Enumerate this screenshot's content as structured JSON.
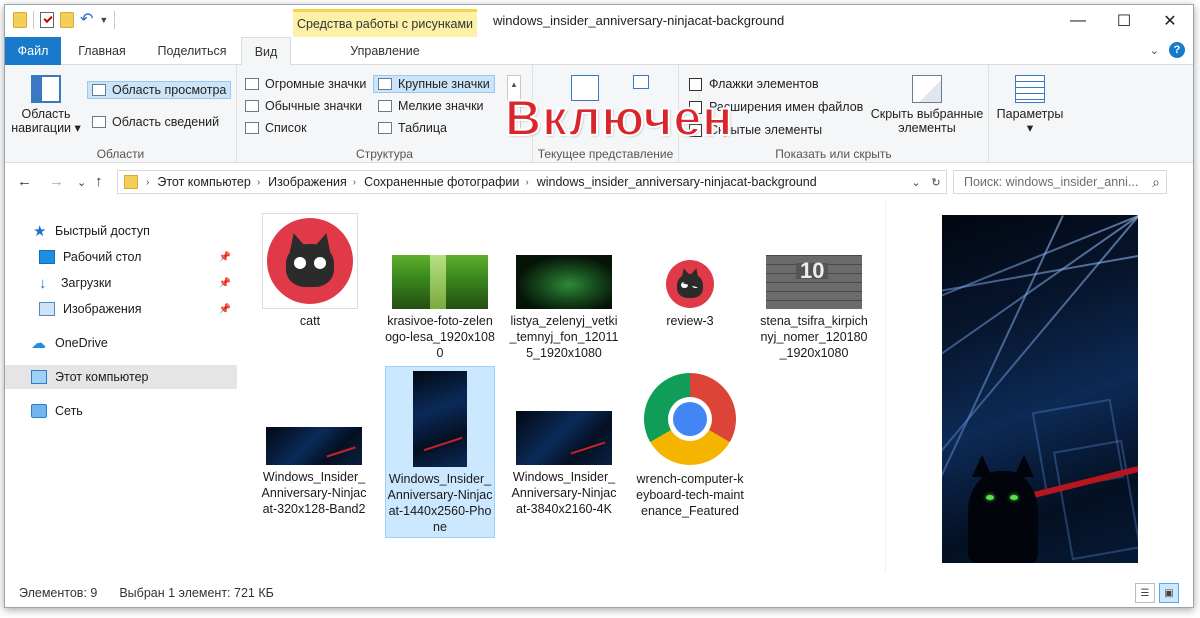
{
  "window": {
    "title": "windows_insider_anniversary-ninjacat-background",
    "context_tools": "Средства работы с рисунками",
    "controls": {
      "minimize": "—",
      "maximize": "☐",
      "close": "✕"
    }
  },
  "ribbon_tabs": {
    "file": "Файл",
    "home": "Главная",
    "share": "Поделиться",
    "view": "Вид",
    "manage": "Управление",
    "collapse": "⌄",
    "help": "?"
  },
  "ribbon": {
    "panes": {
      "label": "Области",
      "nav_pane_line1": "Область",
      "nav_pane_line2": "навигации ▾",
      "preview_pane": "Область просмотра",
      "details_pane": "Область сведений"
    },
    "layout": {
      "label": "Структура",
      "extra_large": "Огромные значки",
      "large": "Крупные значки",
      "medium": "Обычные значки",
      "small": "Мелкие значки",
      "list": "Список",
      "details": "Таблица"
    },
    "current_view": {
      "label": "Текущее представление"
    },
    "show_hide": {
      "label": "Показать или скрыть",
      "item_checkboxes": "Флажки элементов",
      "file_extensions": "Расширения имен файлов",
      "hidden_items": "Скрытые элементы",
      "hide_selected_line1": "Скрыть выбранные",
      "hide_selected_line2": "элементы"
    },
    "options": {
      "label": "Параметры ▾"
    }
  },
  "overlay": {
    "text": "Включен"
  },
  "address": {
    "back": "←",
    "forward": "→",
    "recent": "⌄",
    "up": "↑",
    "crumbs": [
      "Этот компьютер",
      "Изображения",
      "Сохраненные фотографии",
      "windows_insider_anniversary-ninjacat-background"
    ],
    "separator": "›",
    "dropdown": "⌄",
    "refresh": "↻"
  },
  "search": {
    "placeholder": "Поиск: windows_insider_anni...",
    "icon": "⌕"
  },
  "sidebar": {
    "quick_access": "Быстрый доступ",
    "desktop": "Рабочий стол",
    "downloads": "Загрузки",
    "pictures": "Изображения",
    "onedrive": "OneDrive",
    "this_pc": "Этот компьютер",
    "network": "Сеть",
    "pin": "📌"
  },
  "files": [
    {
      "name": "catt"
    },
    {
      "name": "krasivoe-foto-zelenogo-lesa_1920x1080"
    },
    {
      "name": "listya_zelenyj_vetki_temnyj_fon_120115_1920x1080"
    },
    {
      "name": "review-3"
    },
    {
      "name": "stena_tsifra_kirpichnyj_nomer_120180_1920x1080"
    },
    {
      "name": "Windows_Insider_Anniversary-Ninjacat-320x128-Band2"
    },
    {
      "name": "Windows_Insider_Anniversary-Ninjacat-1440x2560-Phone"
    },
    {
      "name": "Windows_Insider_Anniversary-Ninjacat-3840x2160-4K"
    },
    {
      "name": "wrench-computer-keyboard-tech-maintenance_Featured"
    }
  ],
  "wall_number": "10",
  "status": {
    "count": "Элементов: 9",
    "selection": "Выбран 1 элемент: 721 КБ"
  },
  "colors": {
    "accent": "#1979ca",
    "selection": "#cce8ff",
    "overlay_red": "#d9262c"
  }
}
